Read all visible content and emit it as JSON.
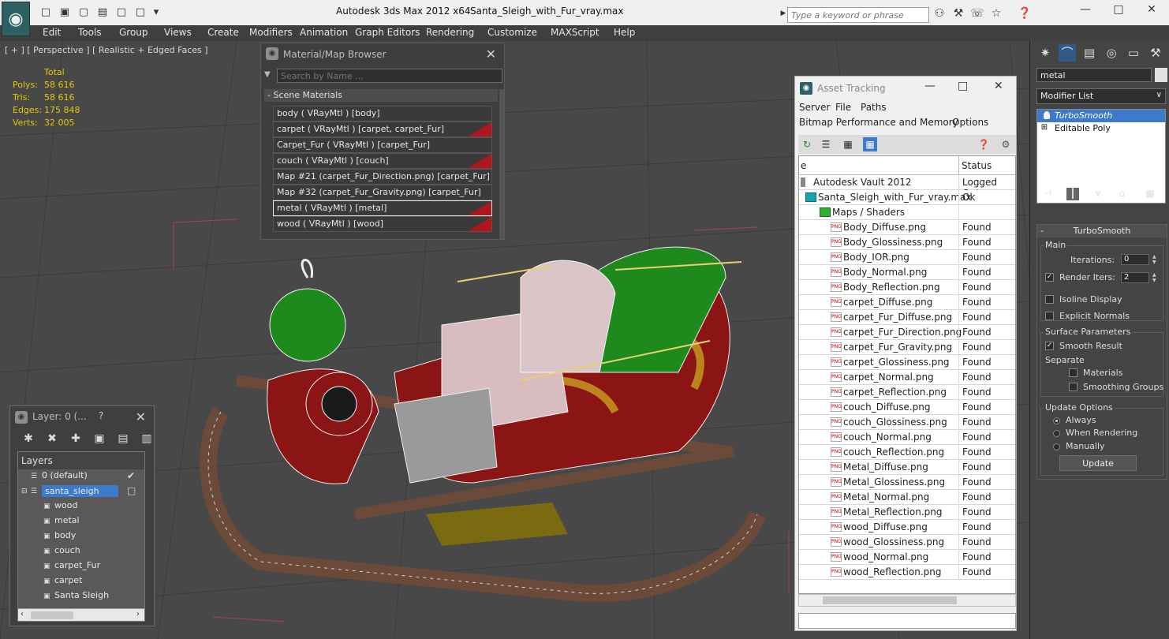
{
  "titlebar": {
    "app_title": "Autodesk 3ds Max  2012 x64",
    "file_name": "Santa_Sleigh_with_Fur_vray.max",
    "search_placeholder": "Type a keyword or phrase",
    "app_icon": "max-logo-icon"
  },
  "menu": [
    "Edit",
    "Tools",
    "Group",
    "Views",
    "Create",
    "Modifiers",
    "Animation",
    "Graph Editors",
    "Rendering",
    "Customize",
    "MAXScript",
    "Help"
  ],
  "viewport": {
    "label": "[ + ] [ Perspective ] [ Realistic + Edged Faces ]",
    "stats": {
      "header": "Total",
      "rows": [
        {
          "k": "Polys:",
          "v": "58 616"
        },
        {
          "k": "Tris:",
          "v": "58 616"
        },
        {
          "k": "Edges:",
          "v": "175 848"
        },
        {
          "k": "Verts:",
          "v": "32 005"
        }
      ]
    }
  },
  "material_browser": {
    "title": "Material/Map Browser",
    "search_placeholder": "Search by Name ...",
    "section": "- Scene Materials",
    "items": [
      {
        "label": "body  ( VRayMtl ) [body]",
        "swatch": false,
        "selected": false
      },
      {
        "label": "carpet  ( VRayMtl ) [carpet, carpet_Fur]",
        "swatch": true,
        "selected": false
      },
      {
        "label": "Carpet_Fur  ( VRayMtl ) [carpet_Fur]",
        "swatch": false,
        "selected": false
      },
      {
        "label": "couch  ( VRayMtl ) [couch]",
        "swatch": true,
        "selected": false
      },
      {
        "label": "Map #21 (carpet_Fur_Direction.png)  [carpet_Fur]",
        "swatch": false,
        "selected": false
      },
      {
        "label": "Map #32 (carpet_Fur_Gravity.png)  [carpet_Fur]",
        "swatch": false,
        "selected": false
      },
      {
        "label": "metal  ( VRayMtl ) [metal]",
        "swatch": true,
        "selected": true
      },
      {
        "label": "wood  ( VRayMtl ) [wood]",
        "swatch": true,
        "selected": false
      }
    ]
  },
  "asset_tracking": {
    "title": "Asset Tracking",
    "menu_row1": [
      "Server",
      "File",
      "Paths"
    ],
    "menu_row2": [
      "Bitmap Performance and Memory",
      "Options"
    ],
    "columns": [
      "e",
      "Status"
    ],
    "rows": [
      {
        "name": "Autodesk Vault 2012",
        "status": "Logged Out",
        "indent": 0,
        "icon": "vault-icon"
      },
      {
        "name": "Santa_Sleigh_with_Fur_vray.max",
        "status": "Ok",
        "indent": 1,
        "icon": "max-file-icon"
      },
      {
        "name": "Maps / Shaders",
        "status": "",
        "indent": 2,
        "icon": "maps-folder-icon"
      },
      {
        "name": "Body_Diffuse.png",
        "status": "Found",
        "indent": 3,
        "icon": "png-icon"
      },
      {
        "name": "Body_Glossiness.png",
        "status": "Found",
        "indent": 3,
        "icon": "png-icon"
      },
      {
        "name": "Body_IOR.png",
        "status": "Found",
        "indent": 3,
        "icon": "png-icon"
      },
      {
        "name": "Body_Normal.png",
        "status": "Found",
        "indent": 3,
        "icon": "png-icon"
      },
      {
        "name": "Body_Reflection.png",
        "status": "Found",
        "indent": 3,
        "icon": "png-icon"
      },
      {
        "name": "carpet_Diffuse.png",
        "status": "Found",
        "indent": 3,
        "icon": "png-icon"
      },
      {
        "name": "carpet_Fur_Diffuse.png",
        "status": "Found",
        "indent": 3,
        "icon": "png-icon"
      },
      {
        "name": "carpet_Fur_Direction.png",
        "status": "Found",
        "indent": 3,
        "icon": "png-icon"
      },
      {
        "name": "carpet_Fur_Gravity.png",
        "status": "Found",
        "indent": 3,
        "icon": "png-icon"
      },
      {
        "name": "carpet_Glossiness.png",
        "status": "Found",
        "indent": 3,
        "icon": "png-icon"
      },
      {
        "name": "carpet_Normal.png",
        "status": "Found",
        "indent": 3,
        "icon": "png-icon"
      },
      {
        "name": "carpet_Reflection.png",
        "status": "Found",
        "indent": 3,
        "icon": "png-icon"
      },
      {
        "name": "couch_Diffuse.png",
        "status": "Found",
        "indent": 3,
        "icon": "png-icon"
      },
      {
        "name": "couch_Glossiness.png",
        "status": "Found",
        "indent": 3,
        "icon": "png-icon"
      },
      {
        "name": "couch_Normal.png",
        "status": "Found",
        "indent": 3,
        "icon": "png-icon"
      },
      {
        "name": "couch_Reflection.png",
        "status": "Found",
        "indent": 3,
        "icon": "png-icon"
      },
      {
        "name": "Metal_Diffuse.png",
        "status": "Found",
        "indent": 3,
        "icon": "png-icon"
      },
      {
        "name": "Metal_Glossiness.png",
        "status": "Found",
        "indent": 3,
        "icon": "png-icon"
      },
      {
        "name": "Metal_Normal.png",
        "status": "Found",
        "indent": 3,
        "icon": "png-icon"
      },
      {
        "name": "Metal_Reflection.png",
        "status": "Found",
        "indent": 3,
        "icon": "png-icon"
      },
      {
        "name": "wood_Diffuse.png",
        "status": "Found",
        "indent": 3,
        "icon": "png-icon"
      },
      {
        "name": "wood_Glossiness.png",
        "status": "Found",
        "indent": 3,
        "icon": "png-icon"
      },
      {
        "name": "wood_Normal.png",
        "status": "Found",
        "indent": 3,
        "icon": "png-icon"
      },
      {
        "name": "wood_Reflection.png",
        "status": "Found",
        "indent": 3,
        "icon": "png-icon"
      }
    ]
  },
  "layers": {
    "title": "Layer: 0 (...",
    "help": "?",
    "header": "Layers",
    "rows": [
      {
        "label": "0 (default)",
        "indent": 1,
        "selected": false,
        "checked": true
      },
      {
        "label": "santa_sleigh",
        "indent": 1,
        "selected": true,
        "checked": false
      },
      {
        "label": "wood",
        "indent": 2,
        "selected": false,
        "checked": false
      },
      {
        "label": "metal",
        "indent": 2,
        "selected": false,
        "checked": false
      },
      {
        "label": "body",
        "indent": 2,
        "selected": false,
        "checked": false
      },
      {
        "label": "couch",
        "indent": 2,
        "selected": false,
        "checked": false
      },
      {
        "label": "carpet_Fur",
        "indent": 2,
        "selected": false,
        "checked": false
      },
      {
        "label": "carpet",
        "indent": 2,
        "selected": false,
        "checked": false
      },
      {
        "label": "Santa Sleigh",
        "indent": 2,
        "selected": false,
        "checked": false
      }
    ]
  },
  "command_panel": {
    "object_name": "metal",
    "modifier_list": "Modifier List",
    "stack": [
      {
        "label": "TurboSmooth",
        "selected": true
      },
      {
        "label": "Editable Poly",
        "selected": false
      }
    ],
    "rollout": {
      "title": "TurboSmooth",
      "main_label": "Main",
      "iterations_label": "Iterations:",
      "iterations_value": "0",
      "render_iters_label": "Render Iters:",
      "render_iters_value": "2",
      "isoline_label": "Isoline Display",
      "explicit_label": "Explicit Normals",
      "surface_label": "Surface Parameters",
      "smooth_label": "Smooth Result",
      "separate_label": "Separate",
      "materials_label": "Materials",
      "smoothing_label": "Smoothing Groups",
      "update_options_label": "Update Options",
      "always_label": "Always",
      "when_rendering_label": "When Rendering",
      "manually_label": "Manually",
      "update_button": "Update"
    }
  }
}
